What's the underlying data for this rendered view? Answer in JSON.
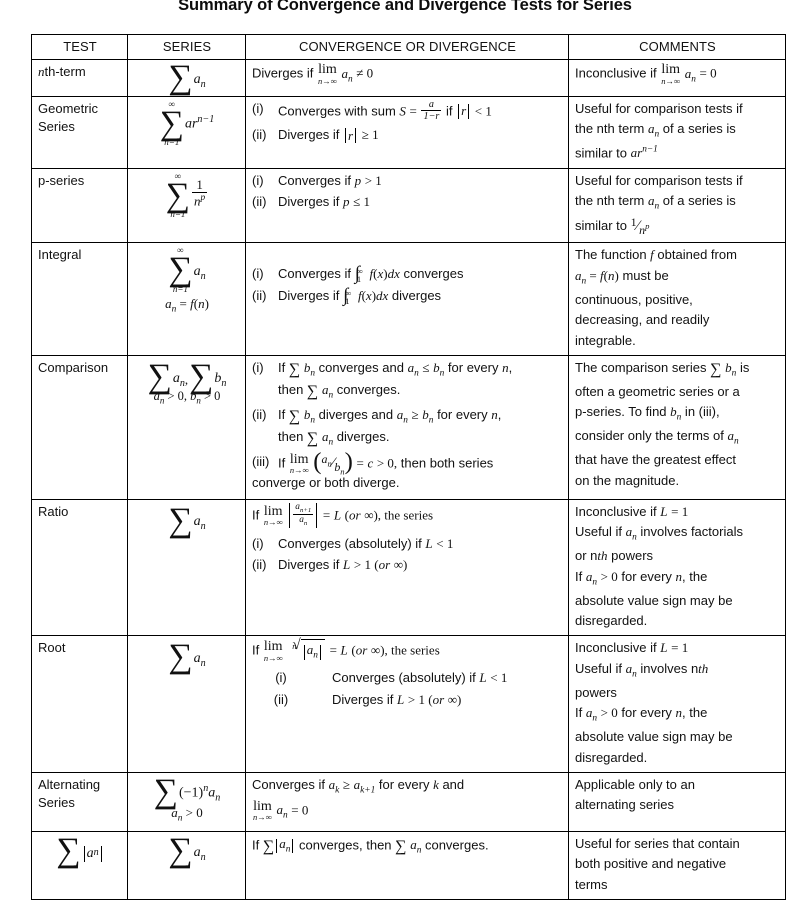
{
  "document": {
    "title": "Summary of Convergence and Divergence Tests for Series"
  },
  "table": {
    "headers": {
      "test": "TEST",
      "series": "SERIES",
      "convergence": "CONVERGENCE OR DIVERGENCE",
      "comments": "COMMENTS"
    },
    "rows": [
      {
        "id": "nth-term",
        "test_name": "nth-term",
        "test_prefix_italic": "n",
        "test_rest": "th-term",
        "series_expr": "∑ aₙ",
        "convergence_text": "Diverges if lim(n→∞) aₙ ≠ 0",
        "conv_lead": "Diverges if",
        "conv_tail": "≠ 0",
        "comments_lead": "Inconclusive if",
        "comments_tail": "= 0",
        "comments_text": "Inconclusive if lim(n→∞) aₙ = 0"
      },
      {
        "id": "geometric-series",
        "test_name": "Geometric Series",
        "test_line1": "Geometric",
        "test_line2": "Series",
        "series_expr": "∑(n=1 to ∞) ar^(n−1)",
        "items": [
          {
            "label": "(i)",
            "text": "Converges with sum S = a/(1−r) if |r| < 1"
          },
          {
            "label": "(ii)",
            "text": "Diverges if |r| ≥ 1"
          }
        ],
        "comments_line1": "Useful for comparison tests if",
        "comments_line2_a": "the nth term",
        "comments_line2_b": "of a series is",
        "comments_line3": "similar to",
        "comments_text": "Useful for comparison tests if the nth term aₙ of a series is similar to ar^(n−1)"
      },
      {
        "id": "p-series",
        "test_name": "p-series",
        "series_expr": "∑(n=1 to ∞) 1/n^p",
        "items": [
          {
            "label": "(i)",
            "text": "Converges if p > 1"
          },
          {
            "label": "(ii)",
            "text": "Diverges if p ≤ 1"
          }
        ],
        "comments_line1": "Useful for comparison tests if",
        "comments_line2_a": "the nth term",
        "comments_line2_b": "of a series is",
        "comments_line3": "similar to",
        "comments_text": "Useful for comparison tests if the nth term aₙ of a series is similar to 1/n^p"
      },
      {
        "id": "integral",
        "test_name": "Integral",
        "series_expr": "∑(n=1 to ∞) aₙ,  aₙ = f(n)",
        "series_note": "aₙ = f(n)",
        "items": [
          {
            "label": "(i)",
            "text": "Converges if ∫₁^∞ f(x)dx converges"
          },
          {
            "label": "(ii)",
            "text": "Diverges if ∫₁^∞ f(x)dx diverges"
          }
        ],
        "comments_line1_a": "The function",
        "comments_line1_b": "obtained from",
        "comments_line2": "must be",
        "comments_line3": "continuous, positive,",
        "comments_line4": "decreasing, and readily",
        "comments_line5": "integrable.",
        "comments_text": "The function f obtained from aₙ = f(n) must be continuous, positive, decreasing, and readily integrable."
      },
      {
        "id": "comparison",
        "test_name": "Comparison",
        "series_expr": "∑ aₙ , ∑ bₙ",
        "series_note": "aₙ > 0, bₙ > 0",
        "items": [
          {
            "label": "(i)",
            "line1": "If ∑ bₙ converges and aₙ ≤ bₙ for every n,",
            "line2": "then ∑ aₙ converges."
          },
          {
            "label": "(ii)",
            "line1": "If ∑ bₙ diverges and aₙ ≥ bₙ for every n,",
            "line2": "then ∑ aₙ diverges."
          },
          {
            "label": "(iii)",
            "line1": "If lim(n→∞) (aₙ/bₙ) = c > 0, then both series",
            "line2": "converge or both diverge."
          }
        ],
        "comments_line1": "The comparison series ∑ bₙ is",
        "comments_line2": "often a geometric series or a",
        "comments_line3": "p-series. To find bₙ in (iii),",
        "comments_line4": "consider only the terms of aₙ",
        "comments_line5": "that have the greatest effect",
        "comments_line6": "on the magnitude.",
        "comments_text": "The comparison series ∑ bₙ is often a geometric series or a p-series. To find bₙ in (iii), consider only the terms of aₙ that have the greatest effect on the magnitude."
      },
      {
        "id": "ratio",
        "test_name": "Ratio",
        "series_expr": "∑ aₙ",
        "lead_text": "If lim(n→∞) |aₙ₊₁/aₙ| = L (or ∞), the series",
        "items": [
          {
            "label": "(i)",
            "text": "Converges (absolutely) if L < 1"
          },
          {
            "label": "(ii)",
            "text": "Diverges if L > 1 (or ∞)"
          }
        ],
        "comments_line1": "Inconclusive if L = 1",
        "comments_line2": "Useful if aₙ involves factorials",
        "comments_line3": "or nth powers",
        "comments_line4": "If aₙ > 0 for every n, the",
        "comments_line5": "absolute value sign may be",
        "comments_line6": "disregarded.",
        "comments_text": "Inconclusive if L = 1. Useful if aₙ involves factorials or nth powers. If aₙ > 0 for every n, the absolute value sign may be disregarded."
      },
      {
        "id": "root",
        "test_name": "Root",
        "series_expr": "∑ aₙ",
        "lead_text": "If lim(n→∞) ⁿ√|aₙ| = L (or ∞), the series",
        "items": [
          {
            "label": "(i)",
            "text": "Converges (absolutely) if L < 1"
          },
          {
            "label": "(ii)",
            "text": "Diverges if L > 1 (or ∞)"
          }
        ],
        "comments_line1": "Inconclusive if L = 1",
        "comments_line2": "Useful if aₙ involves nth",
        "comments_line3": "powers",
        "comments_line4": "If aₙ > 0 for every n, the",
        "comments_line5": "absolute value sign may be",
        "comments_line6": "disregarded.",
        "comments_text": "Inconclusive if L = 1. Useful if aₙ involves nth powers. If aₙ > 0 for every n, the absolute value sign may be disregarded."
      },
      {
        "id": "alternating-series",
        "test_name": "Alternating Series",
        "test_line1": "Alternating",
        "test_line2": "Series",
        "series_expr": "∑ (−1)ⁿ aₙ",
        "series_note": "aₙ > 0",
        "conv_line1": "Converges if aₖ ≥ aₖ₊₁ for every k and",
        "conv_line2": "lim(n→∞) aₙ = 0",
        "comments_line1": "Applicable only to an",
        "comments_line2": "alternating series",
        "comments_text": "Applicable only to an alternating series"
      },
      {
        "id": "absolute-convergence",
        "test_name": "∑ |aₙ|",
        "series_expr": "∑ aₙ",
        "conv_text": "If ∑|aₙ| converges, then ∑ aₙ converges.",
        "comments_line1": "Useful for series that contain",
        "comments_line2": "both positive and negative",
        "comments_line3": "terms",
        "comments_text": "Useful for series that contain both positive and negative terms"
      }
    ]
  }
}
